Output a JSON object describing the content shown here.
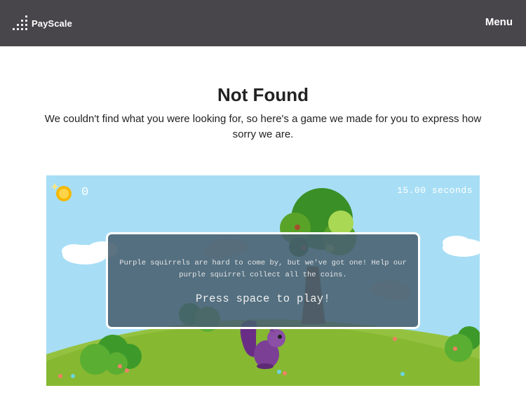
{
  "header": {
    "logo_text": "PayScale",
    "menu_label": "Menu"
  },
  "main": {
    "title": "Not Found",
    "subtitle": "We couldn't find what you were looking for, so here's a game we made for you to express how sorry we are."
  },
  "game": {
    "coin_count": "0",
    "timer": "15.00 seconds",
    "overlay_message": "Purple squirrels are hard to come by, but we've got one! Help our purple squirrel collect all the coins.",
    "play_prompt": "Press space to play!"
  },
  "colors": {
    "header_bg": "#48464b",
    "sky": "#a7def5",
    "grass": "#86b832",
    "squirrel": "#7b3f96"
  }
}
